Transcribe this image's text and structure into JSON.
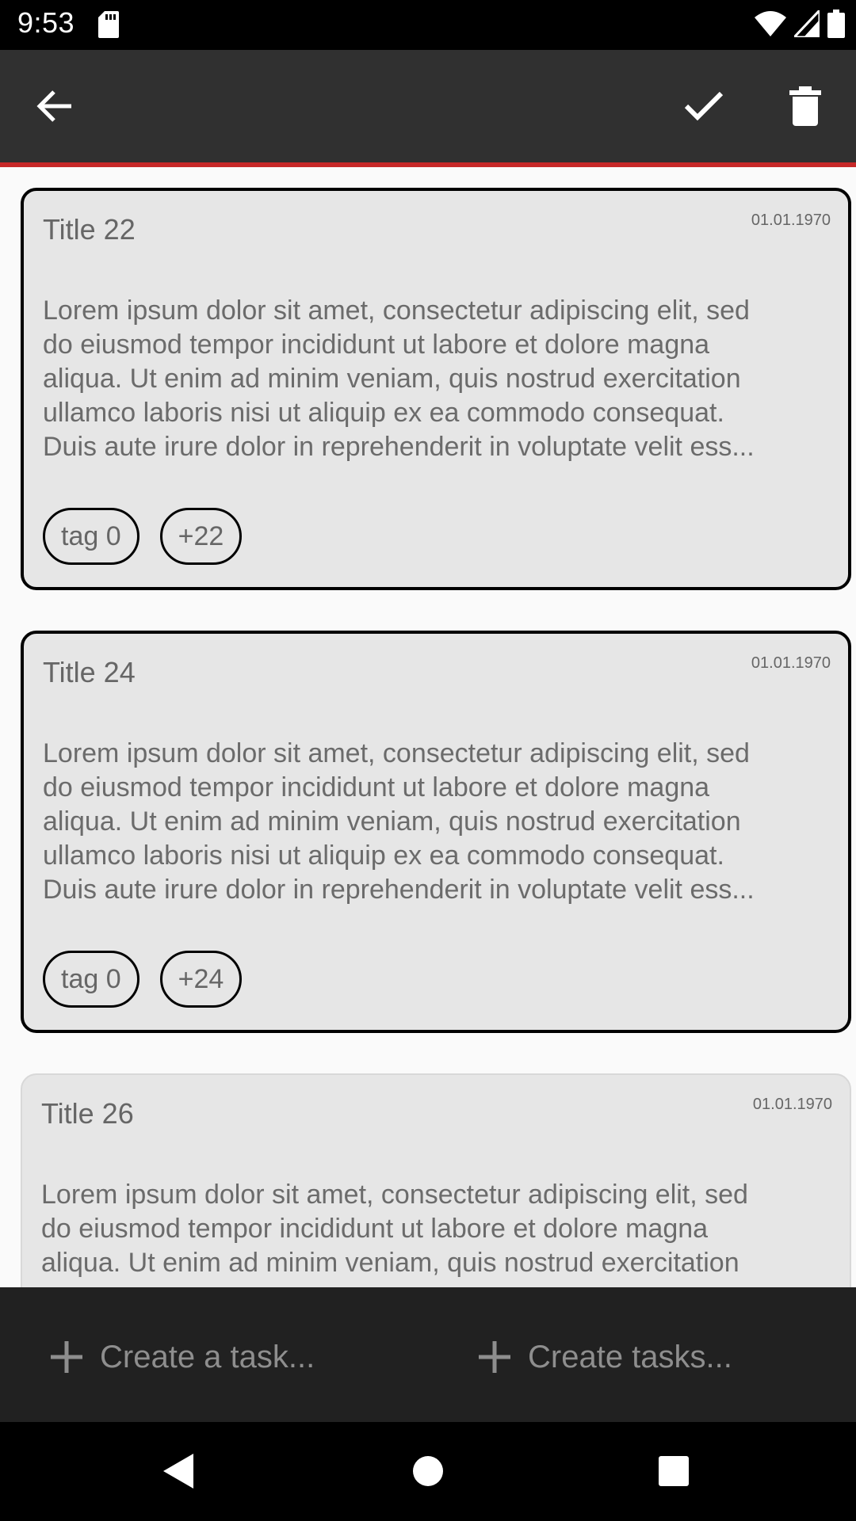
{
  "status_bar": {
    "time": "9:53",
    "icons": [
      "sd-card-icon",
      "wifi-icon",
      "cell-signal-icon",
      "battery-icon"
    ]
  },
  "toolbar": {
    "back_icon": "arrow-left-icon",
    "check_icon": "check-icon",
    "delete_icon": "trash-icon",
    "accent_color": "#c62828",
    "background": "#303030"
  },
  "cards": [
    {
      "title": "Title 22",
      "date": "01.01.1970",
      "lines": [
        "Lorem ipsum dolor sit amet, consectetur adipiscing elit, sed",
        "do eiusmod tempor incididunt ut labore et dolore magna",
        "aliqua. Ut enim ad minim veniam, quis nostrud exercitation",
        "ullamco laboris nisi ut aliquip ex ea commodo consequat.",
        "Duis aute irure dolor in reprehenderit in voluptate velit ess..."
      ],
      "tags": [
        "tag 0",
        "+22"
      ]
    },
    {
      "title": "Title 24",
      "date": "01.01.1970",
      "lines": [
        "Lorem ipsum dolor sit amet, consectetur adipiscing elit, sed",
        "do eiusmod tempor incididunt ut labore et dolore magna",
        "aliqua. Ut enim ad minim veniam, quis nostrud exercitation",
        "ullamco laboris nisi ut aliquip ex ea commodo consequat.",
        "Duis aute irure dolor in reprehenderit in voluptate velit ess..."
      ],
      "tags": [
        "tag 0",
        "+24"
      ]
    },
    {
      "title": "Title 26",
      "date": "01.01.1970",
      "lines": [
        "Lorem ipsum dolor sit amet, consectetur adipiscing elit, sed",
        "do eiusmod tempor incididunt ut labore et dolore magna",
        "aliqua. Ut enim ad minim veniam, quis nostrud exercitation"
      ]
    }
  ],
  "bottom_bar": {
    "create_task": "Create a task...",
    "create_tasks": "Create tasks..."
  },
  "nav_bar": {
    "icons": [
      "nav-back-icon",
      "nav-home-icon",
      "nav-recents-icon"
    ]
  }
}
